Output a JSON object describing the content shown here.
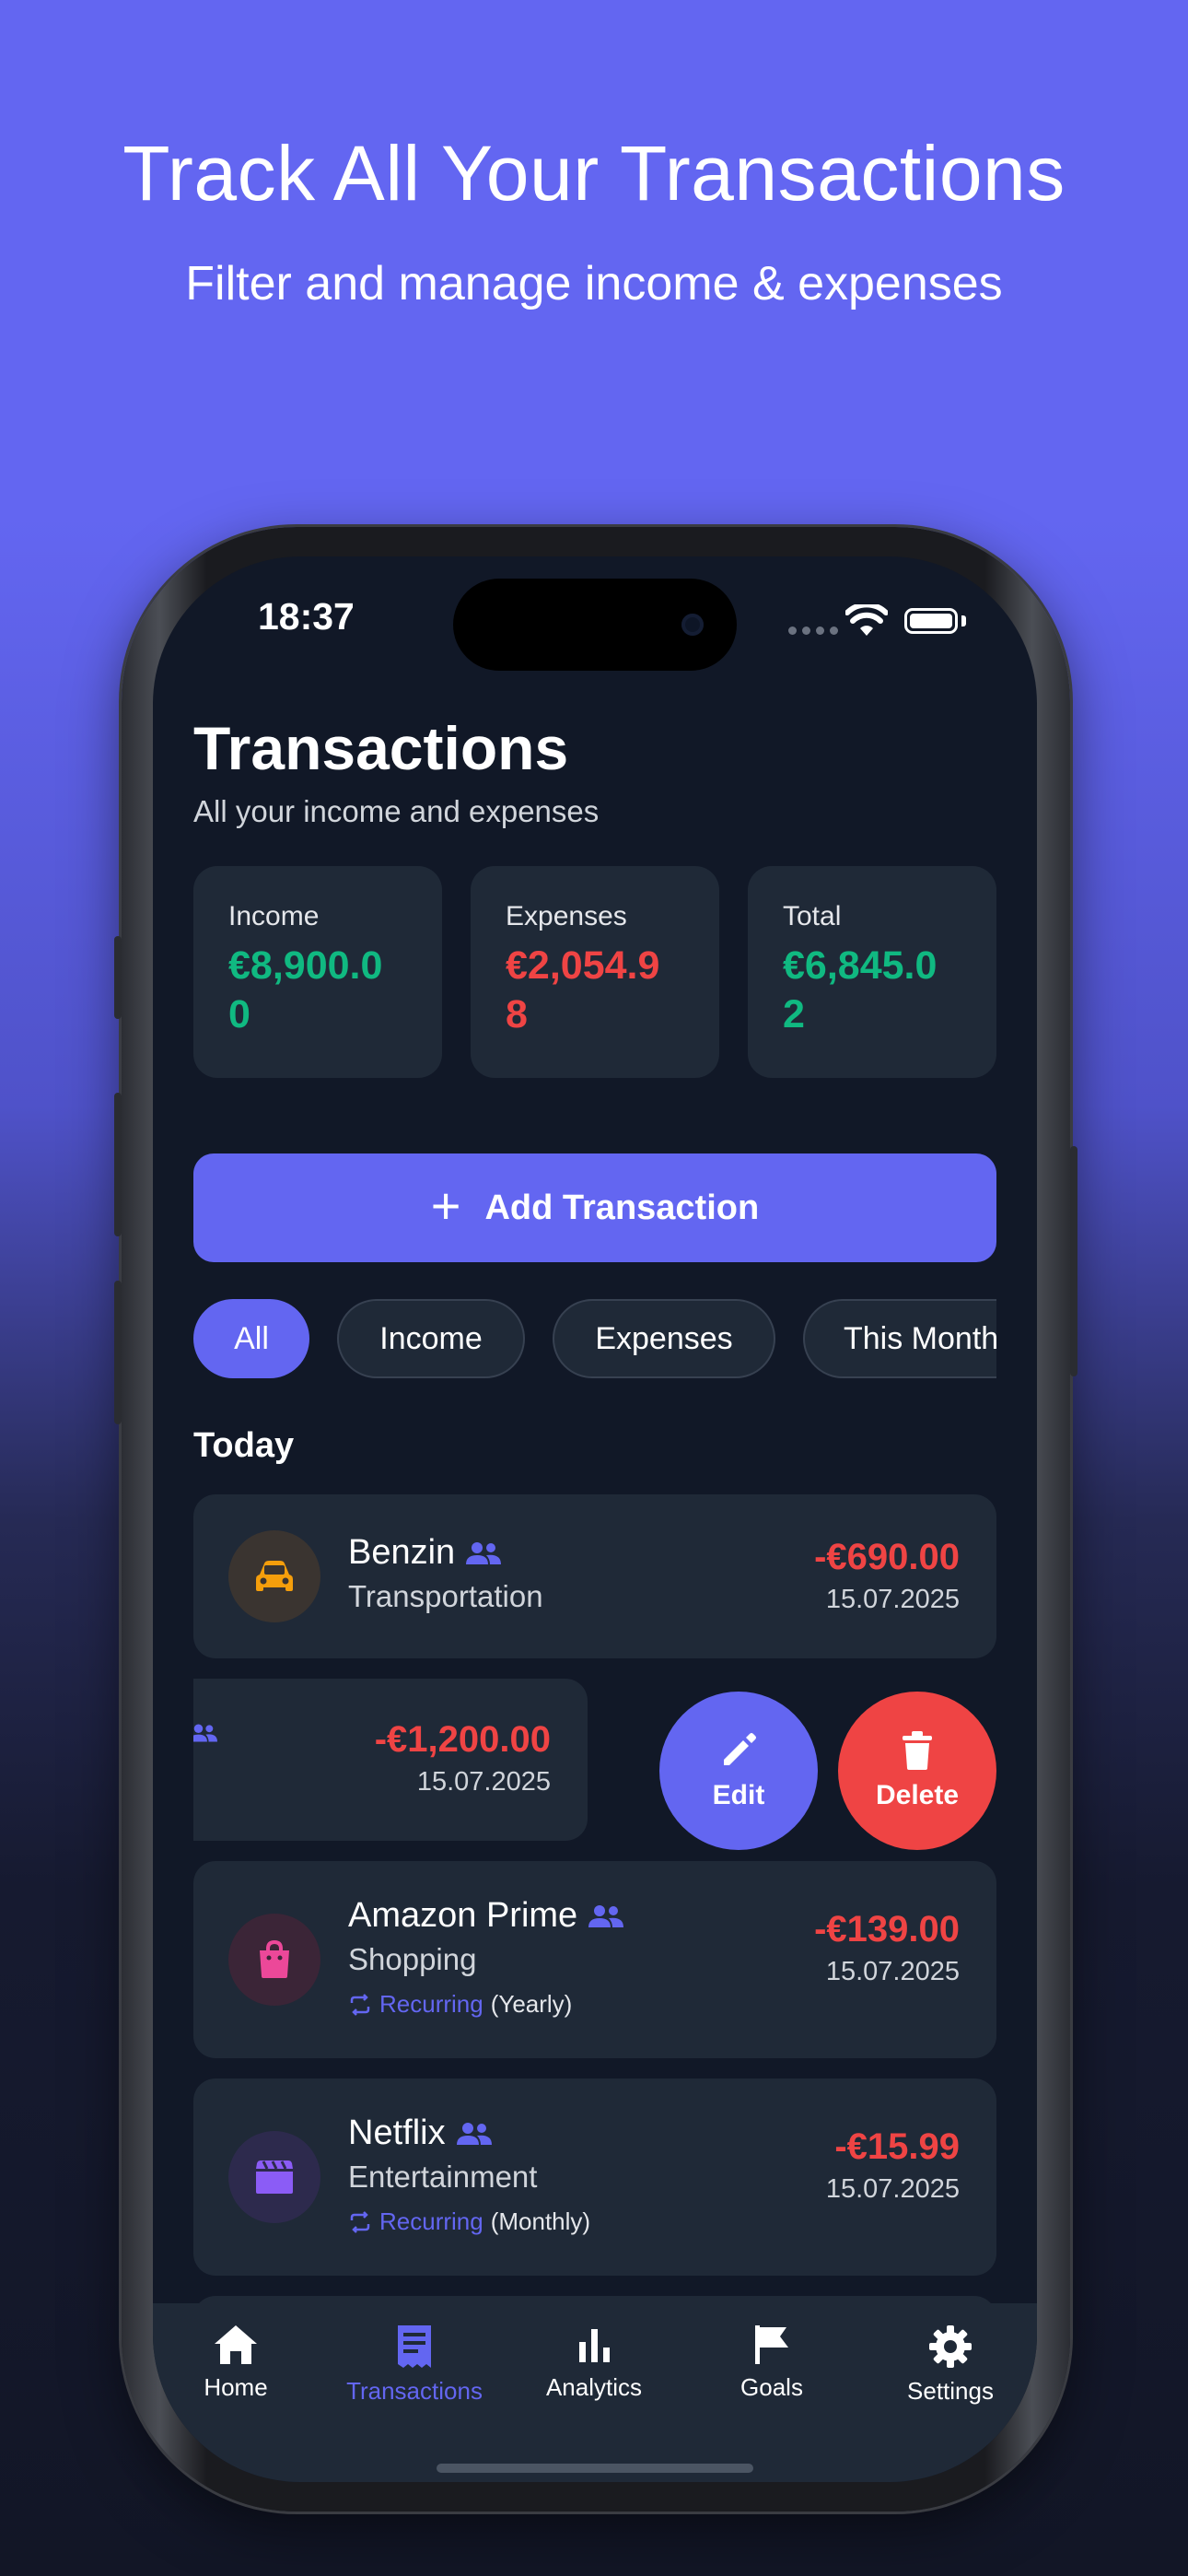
{
  "promo": {
    "title": "Track All Your Transactions",
    "subtitle": "Filter and manage income & expenses"
  },
  "status_bar": {
    "time": "18:37"
  },
  "header": {
    "title": "Transactions",
    "subtitle": "All your income and expenses"
  },
  "summary": [
    {
      "label": "Income",
      "value": "€8,900.00",
      "color": "#10b981"
    },
    {
      "label": "Expenses",
      "value": "€2,054.98",
      "color": "#ef4444"
    },
    {
      "label": "Total",
      "value": "€6,845.02",
      "color": "#10b981"
    }
  ],
  "add_button": {
    "label": "Add Transaction"
  },
  "filters": [
    "All",
    "Income",
    "Expenses",
    "This Month"
  ],
  "active_filter": "All",
  "section": "Today",
  "transactions": [
    {
      "name": "Benzin",
      "category": "Transportation",
      "amount": "-€690.00",
      "date": "15.07.2025",
      "icon": "car-icon",
      "icon_color": "#f59e0b",
      "shared": true
    },
    {
      "name": "",
      "category": "",
      "amount": "-€1,200.00",
      "date": "15.07.2025",
      "icon": "",
      "shared": true,
      "swiped": true
    },
    {
      "name": "Amazon Prime",
      "category": "Shopping",
      "amount": "-€139.00",
      "date": "15.07.2025",
      "icon": "shopping-bag-icon",
      "icon_color": "#ec4899",
      "shared": true,
      "recurring_label": "Recurring",
      "recurring_freq": "(Yearly)"
    },
    {
      "name": "Netflix",
      "category": "Entertainment",
      "amount": "-€15.99",
      "date": "15.07.2025",
      "icon": "clapperboard-icon",
      "icon_color": "#8b5cf6",
      "shared": true,
      "recurring_label": "Recurring",
      "recurring_freq": "(Monthly)"
    }
  ],
  "swipe_actions": [
    {
      "label": "Edit",
      "icon": "pencil-icon",
      "color": "#6366f1"
    },
    {
      "label": "Delete",
      "icon": "trash-icon",
      "color": "#ef4444"
    }
  ],
  "tabbar": [
    {
      "label": "Home",
      "icon": "home-icon"
    },
    {
      "label": "Transactions",
      "icon": "receipt-icon",
      "active": true
    },
    {
      "label": "Analytics",
      "icon": "bar-chart-icon"
    },
    {
      "label": "Goals",
      "icon": "flag-icon"
    },
    {
      "label": "Settings",
      "icon": "gear-icon"
    }
  ],
  "colors": {
    "accent": "#6366f1",
    "expense": "#ef4444",
    "income": "#10b981",
    "card": "#1f2937",
    "screen_bg": "#111827"
  }
}
